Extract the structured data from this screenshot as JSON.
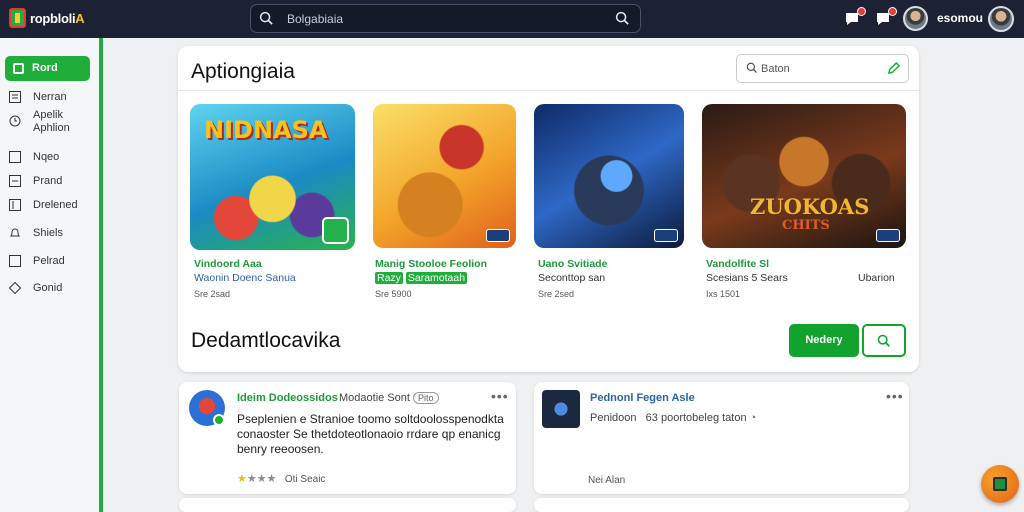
{
  "header": {
    "logo_text_a": "ropbloli",
    "logo_text_b": "A",
    "search_placeholder": "Bolgabiaia",
    "username": "esomou"
  },
  "sidebar": {
    "items": [
      {
        "label": "Rord",
        "icon": "square-icon",
        "active": true
      },
      {
        "label": "Nerran",
        "icon": "list-icon"
      },
      {
        "label": "Apelik\nAphlion",
        "icon": "clock-icon"
      },
      {
        "label": "Nqeo",
        "icon": "square-icon"
      },
      {
        "label": "Prand",
        "icon": "list-icon"
      },
      {
        "label": "Drelened",
        "icon": "book-icon"
      },
      {
        "label": "Shiels",
        "icon": "bell-icon"
      },
      {
        "label": "Pelrad",
        "icon": "square-icon"
      },
      {
        "label": "Gonid",
        "icon": "diamond-icon"
      }
    ]
  },
  "featured": {
    "title": "Aptiongiaia",
    "search_placeholder": "Baton",
    "cards": [
      {
        "title": "Vindoord Aaa",
        "line2": "Waonin Doenc Sanua",
        "line3": "Sre 2sad",
        "art": "NIDNASA",
        "colors": [
          "#4ec9e8",
          "#1b8ac4",
          "#2bb34a"
        ]
      },
      {
        "title": "Manig Stooloe Feolion",
        "line2_a": "Razy",
        "line2_b": "Saramotaah",
        "line3": "Sre 5900",
        "colors": [
          "#f6c531",
          "#f08a1e",
          "#c23322"
        ]
      },
      {
        "title": "Uano Svitiade",
        "line2": "Seconttop san",
        "line3": "Sre 2sed",
        "colors": [
          "#1f3f8f",
          "#2e68c6",
          "#0c1a3a"
        ]
      },
      {
        "title": "Vandolfite Sl",
        "line2": "Scesians 5 Sears",
        "line2_right": "Ubarion",
        "line3": "Ixs 1501",
        "art": "ZUOKOAS",
        "art_sub": "CHITS",
        "colors": [
          "#3a1f1a",
          "#7a3a1c",
          "#1b1410"
        ]
      }
    ],
    "section_title": "Dedamtlocavika",
    "section_button": "Nedery"
  },
  "feed": [
    {
      "title": "Ideim Dodeossidos",
      "sub": "Modaotie Sont",
      "chip": "Pito",
      "body": "Pseplenien e Stranioe toomo soltdoolosspenodkta conaoster Se thetdoteotlonaoio rrdare qp enanicg benry reeoosen.",
      "meta": "Oti Seaic",
      "rating": 3
    },
    {
      "title": "Pednonl Fegen Asle",
      "sub": "Penidoon",
      "sub2": "63 poortobeleg taton",
      "meta": "Nei Alan"
    }
  ]
}
